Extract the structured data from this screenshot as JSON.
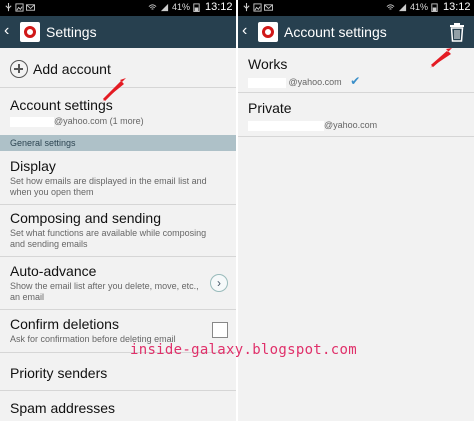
{
  "left": {
    "status": {
      "battery": "41%",
      "time": "13:12"
    },
    "title": "Settings",
    "add_account": "Add account",
    "account_settings": {
      "title": "Account settings",
      "subtitle": "@yahoo.com (1 more)"
    },
    "section_general": "General settings",
    "items": [
      {
        "title": "Display",
        "desc": "Set how emails are displayed in the email list and when you open them"
      },
      {
        "title": "Composing and sending",
        "desc": "Set what functions are available while composing and sending emails"
      },
      {
        "title": "Auto-advance",
        "desc": "Show the email list after you delete, move, etc., an email"
      },
      {
        "title": "Confirm deletions",
        "desc": "Ask for confirmation before deleting email"
      },
      {
        "title": "Priority senders",
        "desc": ""
      },
      {
        "title": "Spam addresses",
        "desc": ""
      }
    ]
  },
  "right": {
    "status": {
      "battery": "41%",
      "time": "13:12"
    },
    "title": "Account settings",
    "accounts": [
      {
        "name": "Works",
        "email": "@yahoo.com"
      },
      {
        "name": "Private",
        "email": "@yahoo.com"
      }
    ]
  },
  "watermark": "inside-galaxy.blogspot.com",
  "colors": {
    "actionbar": "#27404f",
    "section": "#aec1c8",
    "arrow": "#e41b23",
    "watermark": "#e0306a"
  }
}
